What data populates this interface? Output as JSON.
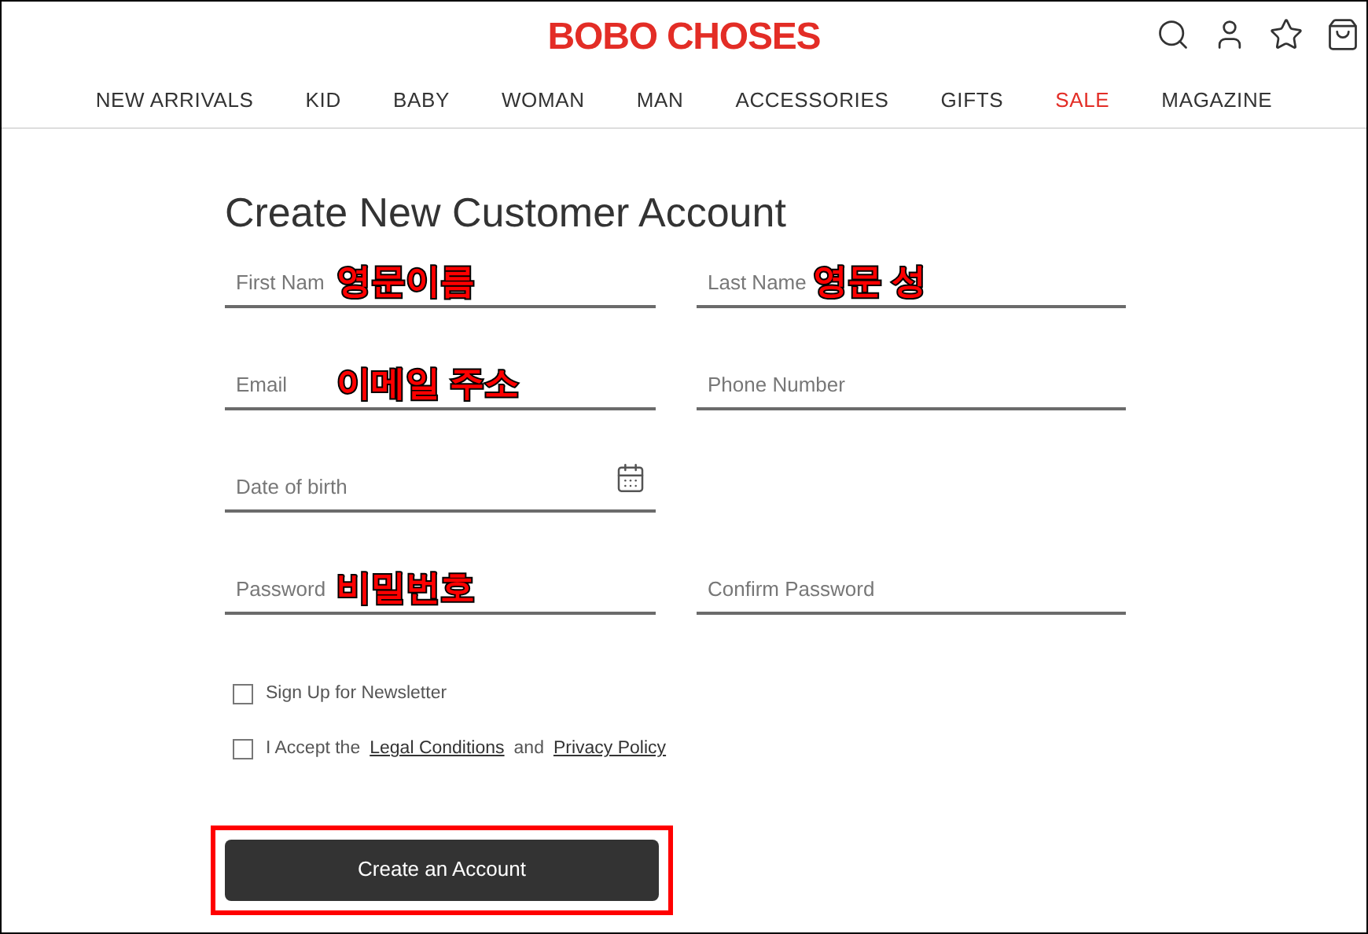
{
  "header": {
    "logo": "BOBO CHOSES"
  },
  "nav": [
    {
      "label": "NEW ARRIVALS",
      "highlight": false
    },
    {
      "label": "KID",
      "highlight": false
    },
    {
      "label": "BABY",
      "highlight": false
    },
    {
      "label": "WOMAN",
      "highlight": false
    },
    {
      "label": "MAN",
      "highlight": false
    },
    {
      "label": "ACCESSORIES",
      "highlight": false
    },
    {
      "label": "GIFTS",
      "highlight": false
    },
    {
      "label": "SALE",
      "highlight": true
    },
    {
      "label": "MAGAZINE",
      "highlight": false
    }
  ],
  "form": {
    "title": "Create New Customer Account",
    "fields": [
      {
        "kind": "text",
        "placeholder": "First Nam",
        "note": "영문이름"
      },
      {
        "kind": "text",
        "placeholder": "Last Name",
        "note": "영문 성"
      },
      {
        "kind": "text",
        "placeholder": "Email",
        "note": "이메일 주소"
      },
      {
        "kind": "text",
        "placeholder": "Phone Number"
      },
      {
        "kind": "date",
        "placeholder": "Date of birth"
      },
      {
        "kind": "empty"
      },
      {
        "kind": "text",
        "placeholder": "Password",
        "note": "비밀번호"
      },
      {
        "kind": "text",
        "placeholder": "Confirm Password"
      }
    ],
    "checkboxes": [
      {
        "checked": false,
        "segments": [
          {
            "text": "Sign Up for Newsletter",
            "link": false
          }
        ]
      },
      {
        "checked": false,
        "segments": [
          {
            "text": "I Accept the",
            "link": false
          },
          {
            "text": "Legal Conditions",
            "link": true
          },
          {
            "text": "and",
            "link": false
          },
          {
            "text": "Privacy Policy",
            "link": true
          }
        ]
      }
    ],
    "button": {
      "label": "Create an Account",
      "highlighted": true
    }
  }
}
